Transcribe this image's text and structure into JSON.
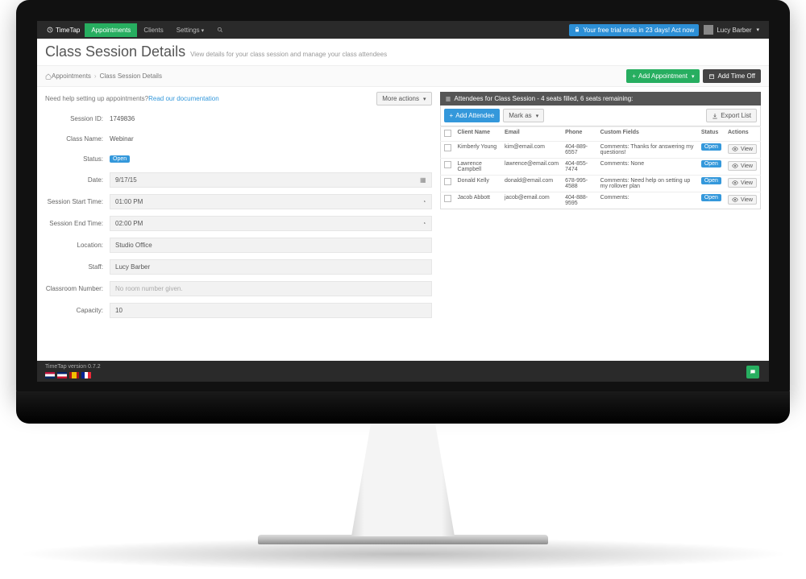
{
  "brand": "TimeTap",
  "nav": {
    "appointments": "Appointments",
    "clients": "Clients",
    "settings": "Settings",
    "trial": "Your free trial ends in 23 days! Act now",
    "user": "Lucy Barber"
  },
  "page": {
    "title": "Class Session Details",
    "subtitle": "View details for your class session and manage your class attendees"
  },
  "breadcrumb": {
    "home": "Appointments",
    "current": "Class Session Details",
    "add_appt": "Add Appointment",
    "add_timeoff": "Add Time Off"
  },
  "help": {
    "text": "Need help setting up appointments? ",
    "link": "Read our documentation",
    "more": "More actions"
  },
  "form": {
    "session_id": {
      "label": "Session ID:",
      "value": "1749836"
    },
    "class_name": {
      "label": "Class Name:",
      "value": "Webinar"
    },
    "status": {
      "label": "Status:",
      "value": "Open"
    },
    "date": {
      "label": "Date:",
      "value": "9/17/15"
    },
    "start": {
      "label": "Session Start Time:",
      "value": "01:00 PM"
    },
    "end": {
      "label": "Session End Time:",
      "value": "02:00 PM"
    },
    "location": {
      "label": "Location:",
      "value": "Studio Office"
    },
    "staff": {
      "label": "Staff:",
      "value": "Lucy Barber"
    },
    "classroom": {
      "label": "Classroom Number:",
      "placeholder": "No room number given."
    },
    "capacity": {
      "label": "Capacity:",
      "value": "10"
    }
  },
  "panel": {
    "title": "Attendees for Class Session - 4 seats filled, 6 seats remaining:",
    "add": "Add Attendee",
    "mark": "Mark as",
    "export": "Export List",
    "cols": {
      "name": "Client Name",
      "email": "Email",
      "phone": "Phone",
      "custom": "Custom Fields",
      "status": "Status",
      "actions": "Actions"
    },
    "view": "View"
  },
  "attendees": [
    {
      "name": "Kimberly Young",
      "email": "kim@email.com",
      "phone": "404-889-6557",
      "custom": "Comments: Thanks for answering my questions!",
      "status": "Open"
    },
    {
      "name": "Lawrence Campbell",
      "email": "lawrence@email.com",
      "phone": "404-855-7474",
      "custom": "Comments: None",
      "status": "Open"
    },
    {
      "name": "Donald Kelly",
      "email": "donald@email.com",
      "phone": "678-995-4588",
      "custom": "Comments: Need help on setting up my rollover plan",
      "status": "Open"
    },
    {
      "name": "Jacob Abbott",
      "email": "jacob@email.com",
      "phone": "404-888-9595",
      "custom": "Comments:",
      "status": "Open"
    }
  ],
  "footer": {
    "version": "TimeTap version 0.7.2"
  }
}
